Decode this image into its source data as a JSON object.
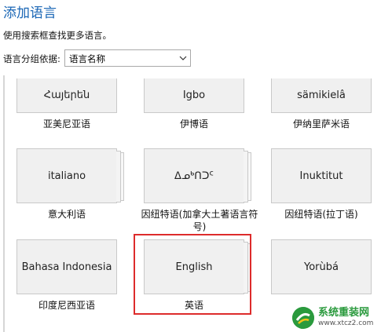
{
  "header": {
    "title": "添加语言",
    "description": "使用搜索框查找更多语言。",
    "group_label": "语言分组依据:",
    "group_select_value": "语言名称"
  },
  "languages": [
    {
      "native": "Հայերեն",
      "name": "亚美尼亚语"
    },
    {
      "native": "Igbo",
      "name": "伊博语"
    },
    {
      "native": "sämikielâ",
      "name": "伊纳里萨米语"
    },
    {
      "native": "italiano",
      "name": "意大利语"
    },
    {
      "native": "ᐃᓄᒃᑎᑐᑦ",
      "name": "因纽特语(加拿大土著语言符号)"
    },
    {
      "native": "Inuktitut",
      "name": "因纽特语(拉丁语)"
    },
    {
      "native": "Bahasa Indonesia",
      "name": "印度尼西亚语"
    },
    {
      "native": "English",
      "name": "英语"
    },
    {
      "native": "Yorùbá",
      "name": ""
    }
  ],
  "watermark": {
    "name": "系统重装网",
    "url": "www.xtcz2.com"
  },
  "colors": {
    "title": "#1a66b5",
    "highlight": "#dd2b2b",
    "tile_bg": "#f0f0f0",
    "watermark": "#2a9a3d"
  }
}
